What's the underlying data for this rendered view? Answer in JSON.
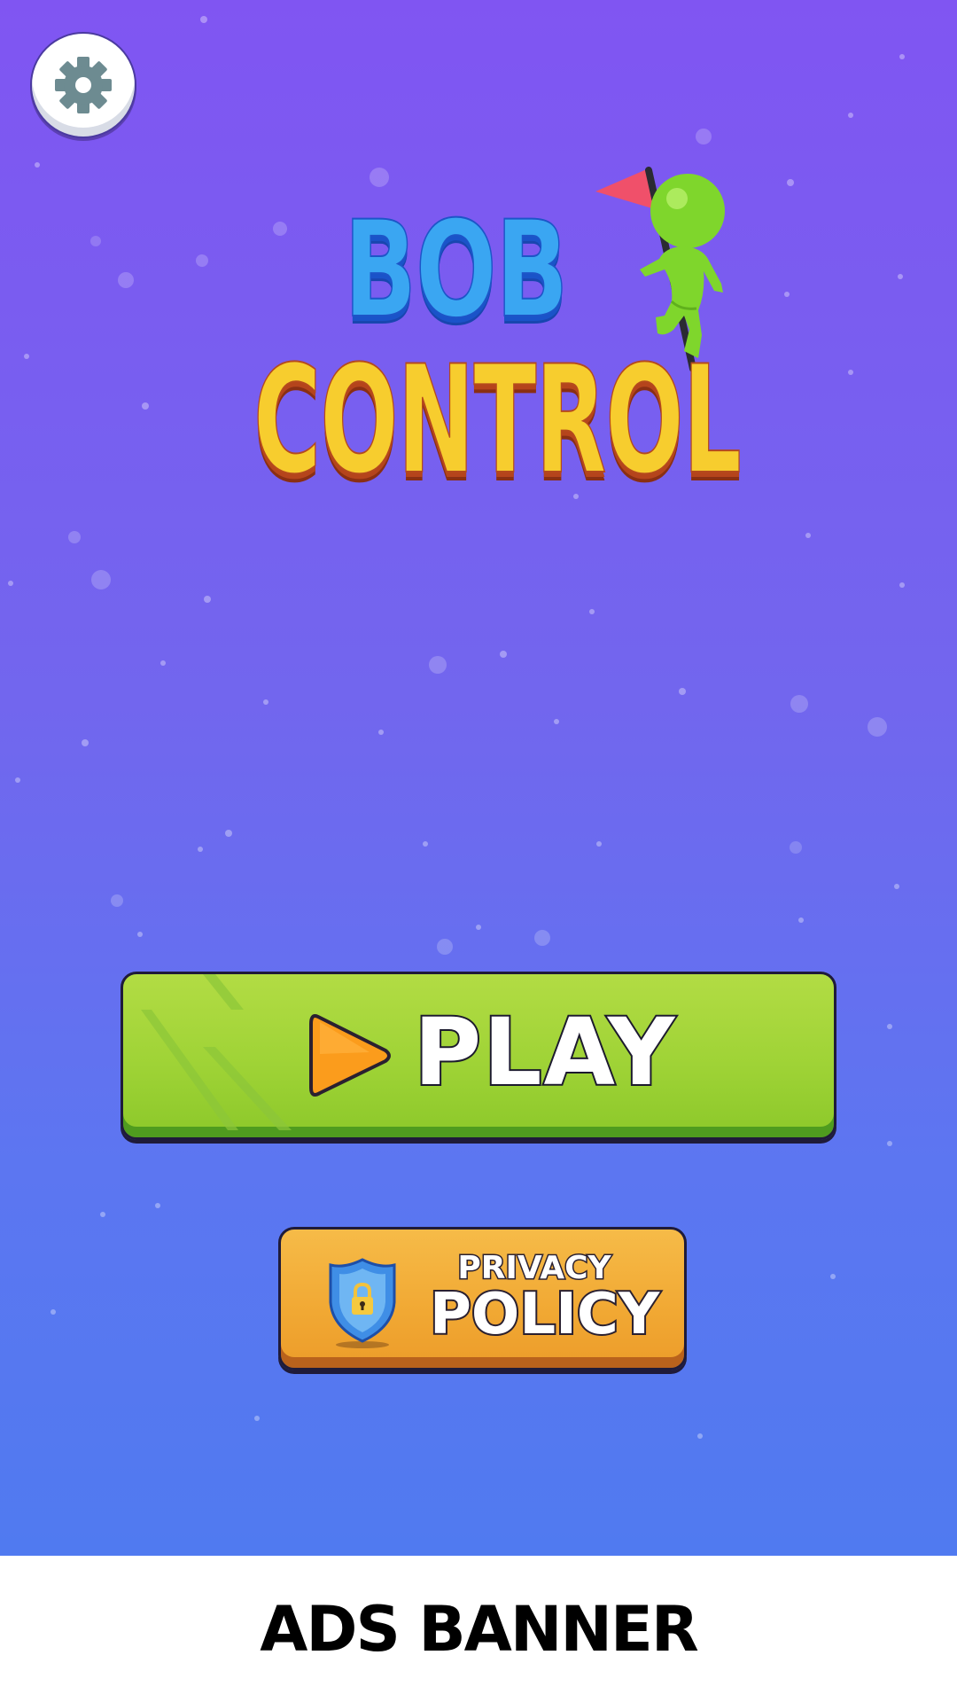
{
  "app": {
    "title_line1": "BOB",
    "title_line2": "CONTROL"
  },
  "settings": {
    "icon": "gear-icon"
  },
  "buttons": {
    "play_label": "PLAY",
    "play_icon": "play-triangle-icon",
    "privacy_line1": "PRIVACY",
    "privacy_line2": "POLICY",
    "privacy_icon": "shield-lock-icon"
  },
  "ads": {
    "label": "ADS BANNER"
  },
  "colors": {
    "background_top": "#8055f2",
    "background_bottom": "#507af0",
    "play_green": "#9fd336",
    "privacy_orange": "#f1a833",
    "title_blue": "#3aa6f2",
    "title_yellow": "#f7cd2e"
  }
}
